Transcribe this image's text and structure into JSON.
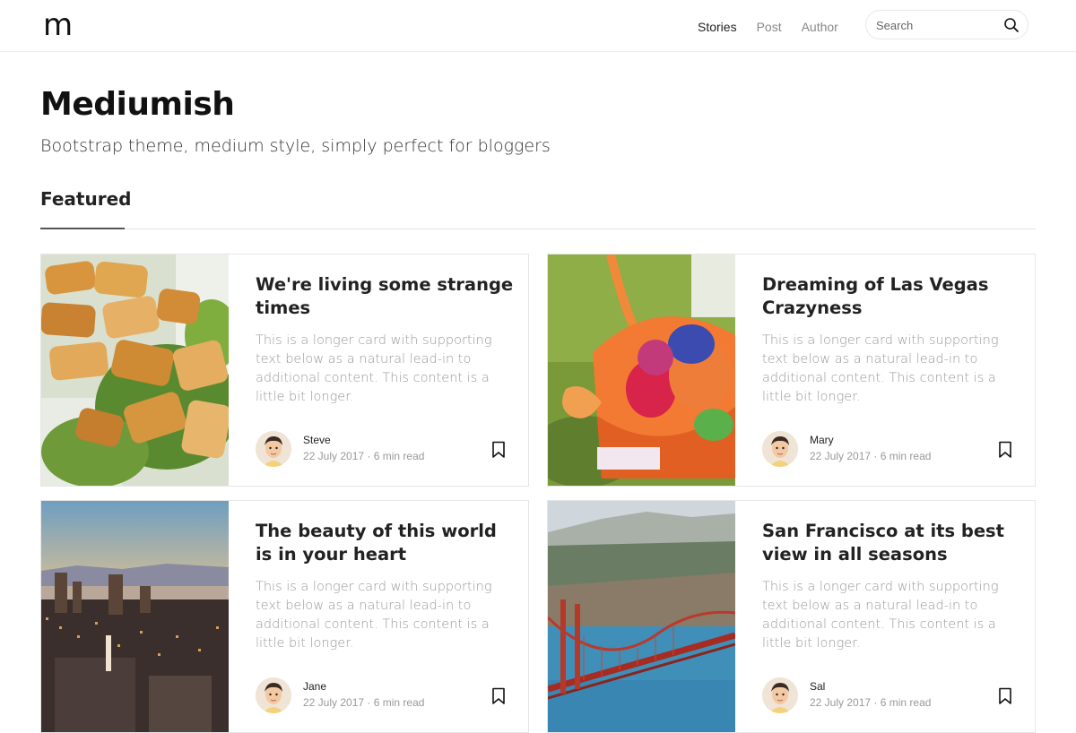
{
  "navbar": {
    "logo": "m",
    "links": [
      {
        "label": "Stories",
        "active": true
      },
      {
        "label": "Post",
        "active": false
      },
      {
        "label": "Author",
        "active": false
      }
    ],
    "search_placeholder": "Search",
    "search_icon": "search-icon"
  },
  "hero": {
    "title": "Mediumish",
    "tagline": "Bootstrap theme, medium style, simply perfect for bloggers"
  },
  "featured": {
    "heading": "Featured",
    "posts": [
      {
        "title": "We're living some strange times",
        "text": "This is a longer card with supporting text below as a natural lead-in to additional content. This content is a little bit longer.",
        "author": "Steve",
        "date": "22 July 2017 · 6 min read",
        "image": "food-salad-image"
      },
      {
        "title": "Dreaming of Las Vegas Crazyness",
        "text": "This is a longer card with supporting text below as a natural lead-in to additional content. This content is a little bit longer.",
        "author": "Mary",
        "date": "22 July 2017 · 6 min read",
        "image": "easter-basket-image"
      },
      {
        "title": "The beauty of this world is in your heart",
        "text": "This is a longer card with supporting text below as a natural lead-in to additional content. This content is a little bit longer.",
        "author": "Jane",
        "date": "22 July 2017 · 6 min read",
        "image": "city-sunset-image"
      },
      {
        "title": "San Francisco at its best view in all seasons",
        "text": "This is a longer card with supporting text below as a natural lead-in to additional content. This content is a little bit longer.",
        "author": "Sal",
        "date": "22 July 2017 · 6 min read",
        "image": "golden-gate-bridge-image"
      }
    ]
  },
  "colors": {
    "text_dark": "#222222",
    "text_muted": "#999999",
    "border": "#e6e6e6"
  }
}
